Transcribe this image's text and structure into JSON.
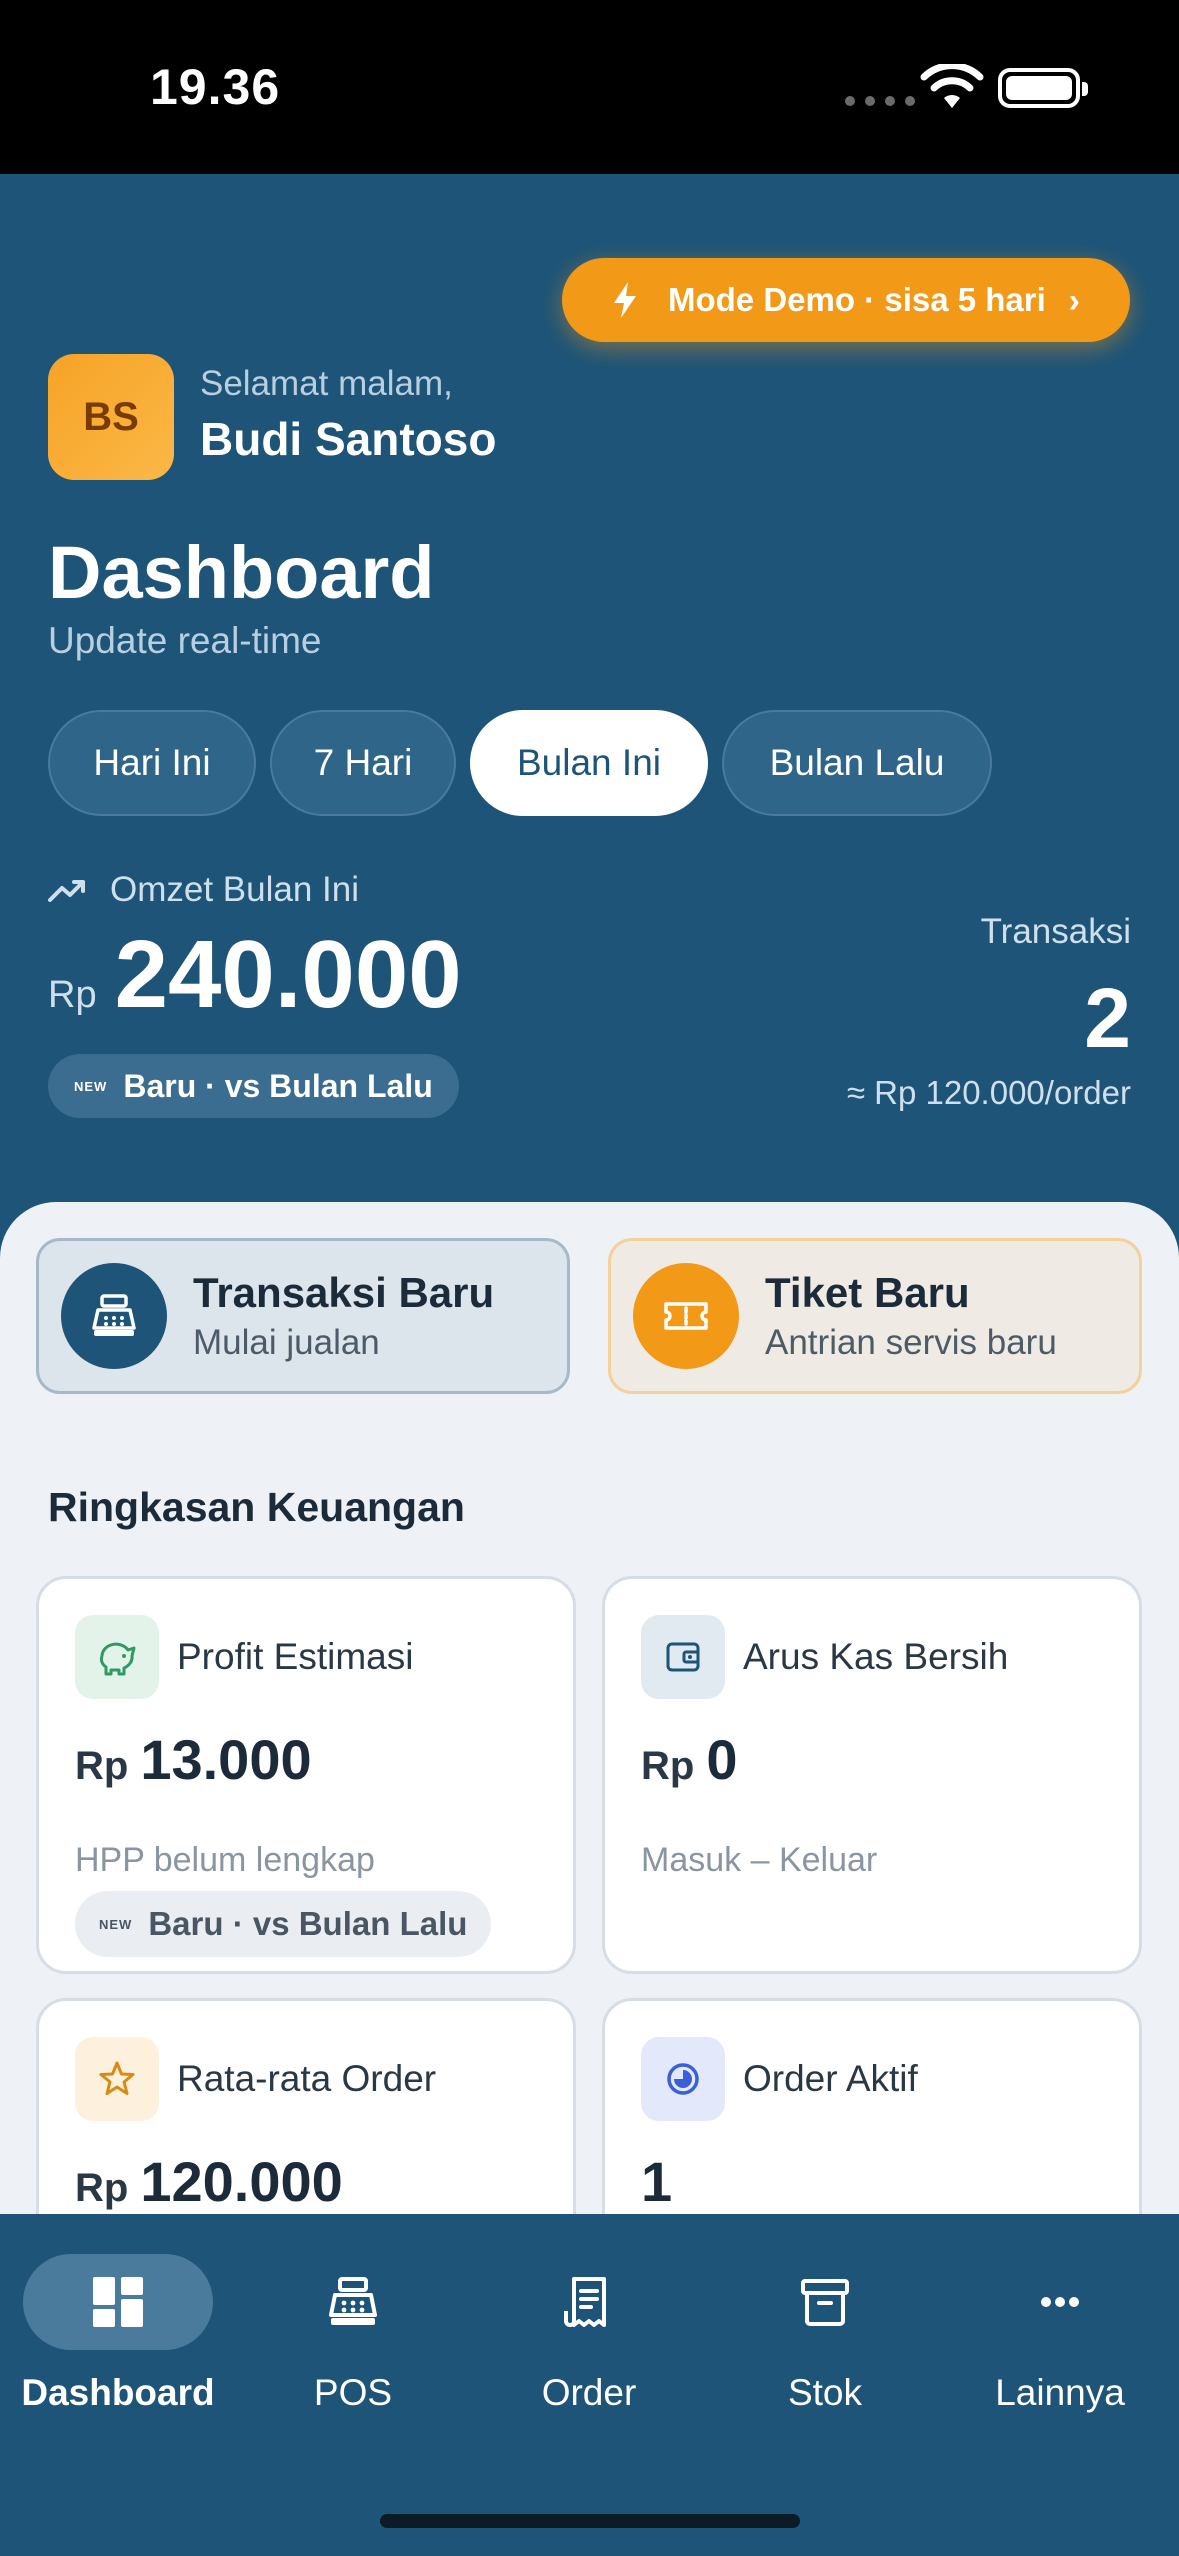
{
  "status_bar": {
    "time": "19.36"
  },
  "header": {
    "demo_badge": "Mode Demo · sisa 5 hari",
    "avatar_initials": "BS",
    "greeting": "Selamat malam,",
    "user_name": "Budi Santoso",
    "title": "Dashboard",
    "subtitle": "Update real-time",
    "period_tabs": [
      {
        "label": "Hari Ini",
        "active": false
      },
      {
        "label": "7 Hari",
        "active": false
      },
      {
        "label": "Bulan Ini",
        "active": true
      },
      {
        "label": "Bulan Lalu",
        "active": false
      }
    ],
    "omzet": {
      "label": "Omzet Bulan Ini",
      "currency": "Rp",
      "value": "240.000",
      "badge_new": "NEW",
      "badge": "Baru · vs Bulan Lalu"
    },
    "transactions": {
      "label": "Transaksi",
      "count": "2",
      "average": "≈ Rp 120.000/order"
    }
  },
  "actions": [
    {
      "title": "Transaksi Baru",
      "subtitle": "Mulai jualan",
      "icon": "cash-register-icon"
    },
    {
      "title": "Tiket Baru",
      "subtitle": "Antrian servis baru",
      "icon": "ticket-icon"
    }
  ],
  "summary": {
    "title": "Ringkasan Keuangan",
    "cards": [
      {
        "label": "Profit Estimasi",
        "currency": "Rp",
        "value": "13.000",
        "sub": "HPP belum lengkap",
        "badge_new": "NEW",
        "badge": "Baru · vs Bulan Lalu",
        "icon": "piggy-bank-icon"
      },
      {
        "label": "Arus Kas Bersih",
        "currency": "Rp",
        "value": "0",
        "sub": "Masuk – Keluar",
        "icon": "wallet-icon"
      },
      {
        "label": "Rata-rata Order",
        "currency": "Rp",
        "value": "120.000",
        "icon": "star-icon"
      },
      {
        "label": "Order Aktif",
        "value": "1",
        "icon": "clock-icon"
      }
    ]
  },
  "bottom_nav": [
    {
      "label": "Dashboard",
      "icon": "dashboard-icon",
      "active": true
    },
    {
      "label": "POS",
      "icon": "cash-register-icon",
      "active": false
    },
    {
      "label": "Order",
      "icon": "receipt-icon",
      "active": false
    },
    {
      "label": "Stok",
      "icon": "archive-box-icon",
      "active": false
    },
    {
      "label": "Lainnya",
      "icon": "more-icon",
      "active": false
    }
  ],
  "colors": {
    "primary": "#1d5478",
    "accent": "#f29a17",
    "background": "#eef1f5"
  }
}
